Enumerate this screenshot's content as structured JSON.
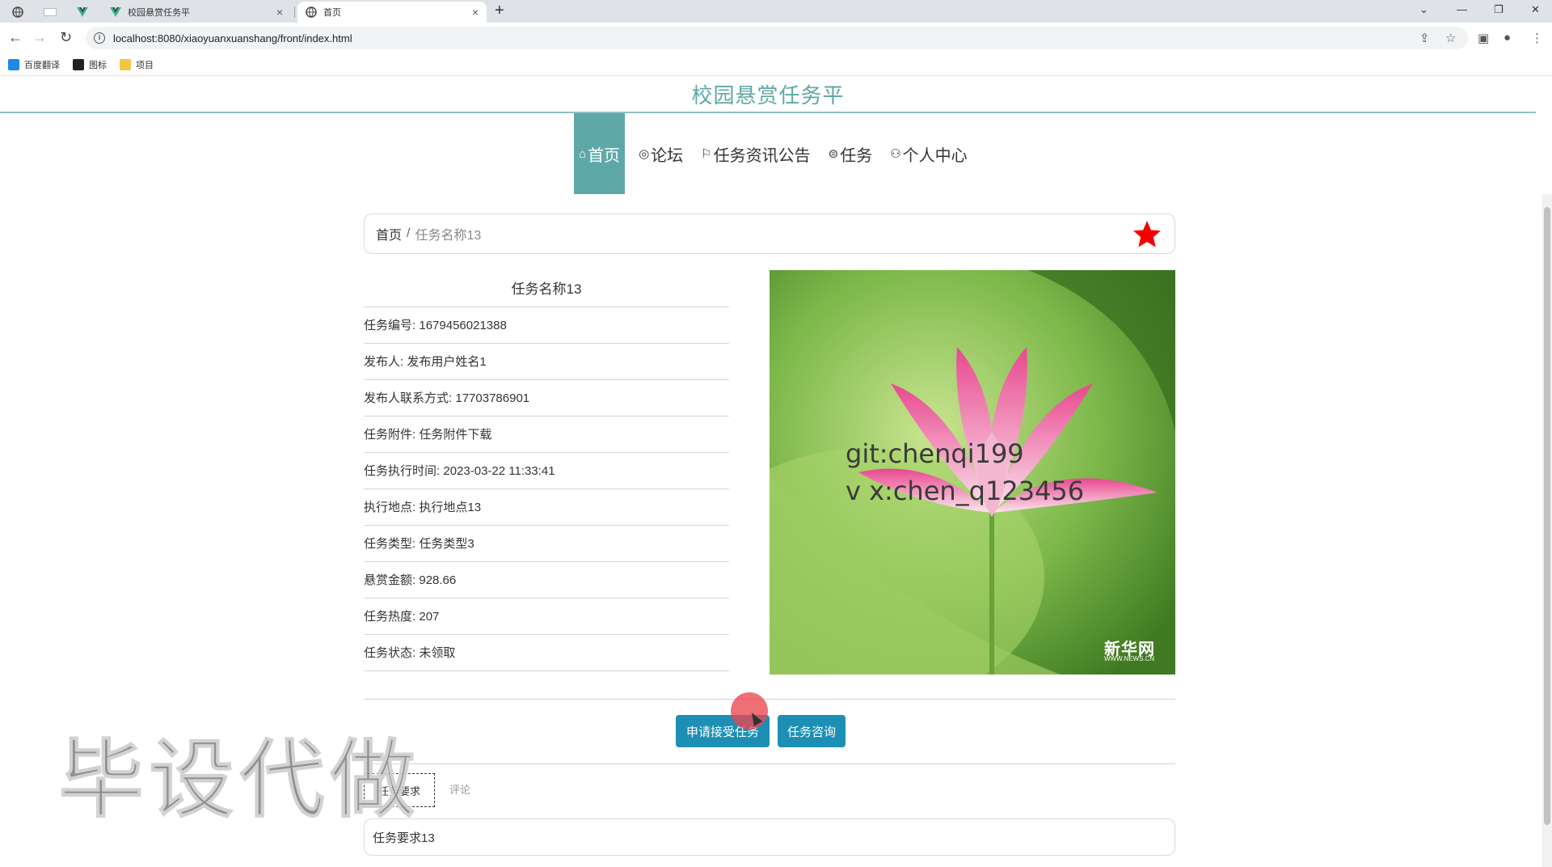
{
  "browser": {
    "tabs": [
      {
        "title": "校园悬赏任务平",
        "active": false
      },
      {
        "title": "首页",
        "active": true
      }
    ],
    "new_tab_label": "+",
    "url": "localhost:8080/xiaoyuanxuanshang/front/index.html",
    "bookmarks": [
      {
        "label": "百度翻译",
        "color": "#1e88e5"
      },
      {
        "label": "图标",
        "color": "#222222"
      },
      {
        "label": "项目",
        "color": "#f4c542"
      }
    ]
  },
  "site": {
    "title": "校园悬赏任务平",
    "accent": "#5fa8a8"
  },
  "nav": [
    {
      "label": "首页",
      "icon": "home-icon",
      "glyph": "⌂",
      "active": true
    },
    {
      "label": "论坛",
      "icon": "chat-icon",
      "glyph": "◎",
      "active": false
    },
    {
      "label": "任务资讯公告",
      "icon": "flag-icon",
      "glyph": "⚐",
      "active": false
    },
    {
      "label": "任务",
      "icon": "task-icon",
      "glyph": "⊜",
      "active": false
    },
    {
      "label": "个人中心",
      "icon": "user-icon",
      "glyph": "⚇",
      "active": false
    }
  ],
  "breadcrumb": {
    "home": "首页",
    "separator": "/",
    "current": "任务名称13"
  },
  "task": {
    "title": "任务名称13",
    "fields": [
      {
        "label": "任务编号",
        "value": "1679456021388"
      },
      {
        "label": "发布人",
        "value": "发布用户姓名1"
      },
      {
        "label": "发布人联系方式",
        "value": "17703786901"
      },
      {
        "label": "任务附件",
        "value": "任务附件下载"
      },
      {
        "label": "任务执行时间",
        "value": "2023-03-22 11:33:41"
      },
      {
        "label": "执行地点",
        "value": "执行地点13"
      },
      {
        "label": "任务类型",
        "value": "任务类型3"
      },
      {
        "label": "悬赏金额",
        "value": "928.66"
      },
      {
        "label": "任务热度",
        "value": "207"
      },
      {
        "label": "任务状态",
        "value": "未领取"
      }
    ]
  },
  "image": {
    "watermark_line1": "git:chenqi199",
    "watermark_line2": "v x:chen_q123456",
    "logo": "新华网",
    "logo_sub": "WWW.NEWS.CN"
  },
  "actions": {
    "accept_label": "申请接受任务",
    "consult_label": "任务咨询",
    "button_color": "#1d8fb5"
  },
  "detail_tabs": {
    "requirements_label": "任务要求",
    "comments_label": "评论",
    "requirements_text": "任务要求13"
  },
  "overlay": "毕设代做"
}
